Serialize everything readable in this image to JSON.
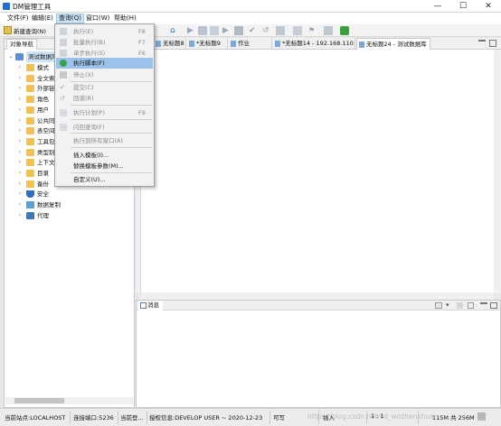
{
  "window": {
    "title": "DM管理工具",
    "controls": [
      "—",
      "☐",
      "✕"
    ]
  },
  "menubar": {
    "items": [
      "文件(F)",
      "编辑(E)",
      "查询(Q)",
      "窗口(W)",
      "帮助(H)"
    ],
    "active_index": 2
  },
  "toolbar": {
    "new_query_label": "新建查询(N)"
  },
  "query_menu": {
    "items": [
      {
        "label": "执行(E)",
        "shortcut": "F8",
        "enabled": false
      },
      {
        "label": "批量执行(B)",
        "shortcut": "F7",
        "enabled": false
      },
      {
        "label": "单步执行(S)",
        "shortcut": "F6",
        "enabled": false
      },
      {
        "label": "执行脚本(F)",
        "shortcut": "",
        "enabled": true,
        "highlighted": true
      },
      {
        "label": "停止(X)",
        "shortcut": "",
        "enabled": false
      },
      {
        "label": "提交(C)",
        "shortcut": "",
        "enabled": false
      },
      {
        "label": "回滚(R)",
        "shortcut": "",
        "enabled": false
      },
      {
        "label": "执行计划(P)",
        "shortcut": "F9",
        "enabled": false
      },
      {
        "label": "闪回查询(F)",
        "shortcut": "",
        "enabled": false
      },
      {
        "label": "执行到所有窗口(A)",
        "shortcut": "",
        "enabled": false
      },
      {
        "label": "插入模板(I)...",
        "shortcut": "",
        "enabled": true
      },
      {
        "label": "替换模板参数(M)...",
        "shortcut": "",
        "enabled": true
      },
      {
        "label": "自定义(U)...",
        "shortcut": "",
        "enabled": true
      }
    ]
  },
  "object_nav": {
    "tab_label": "对象导航",
    "root_label": "测试数据库",
    "tree": [
      {
        "label": "模式",
        "icon": "folder-icon"
      },
      {
        "label": "全文索",
        "icon": "folder-icon"
      },
      {
        "label": "外部链",
        "icon": "folder-icon"
      },
      {
        "label": "角色",
        "icon": "folder-icon"
      },
      {
        "label": "用户",
        "icon": "folder-icon"
      },
      {
        "label": "公共同",
        "icon": "folder-icon"
      },
      {
        "label": "表空间",
        "icon": "folder-icon"
      },
      {
        "label": "工具包",
        "icon": "folder-icon"
      },
      {
        "label": "类型别",
        "icon": "folder-icon"
      },
      {
        "label": "上下文",
        "icon": "folder-icon"
      },
      {
        "label": "目录",
        "icon": "folder-icon"
      },
      {
        "label": "备份",
        "icon": "folder-icon"
      },
      {
        "label": "安全",
        "icon": "shield-icon"
      },
      {
        "label": "数据复制",
        "icon": "replication-icon"
      },
      {
        "label": "代理",
        "icon": "agent-icon"
      }
    ]
  },
  "editor_tabs": [
    {
      "label": "无标题8"
    },
    {
      "label": "*无标题9"
    },
    {
      "label": "作业"
    },
    {
      "label": "*无标题14 - 192.168.110"
    },
    {
      "label": "无标题24 - 测试数据库"
    }
  ],
  "messages_panel": {
    "tab_label": "消息"
  },
  "statusbar": {
    "site": "当前站点:LOCALHOST",
    "port": "连接端口:5236",
    "current": "当前登...",
    "license": "授权信息:DEVELOP USER ~ 2020-12-23",
    "writable": "可写",
    "insert": "插入",
    "position": "1 : 1",
    "memory": "115M 共 256M"
  },
  "watermark": "https://blog.csdn.net/sd_wozhenshuai"
}
